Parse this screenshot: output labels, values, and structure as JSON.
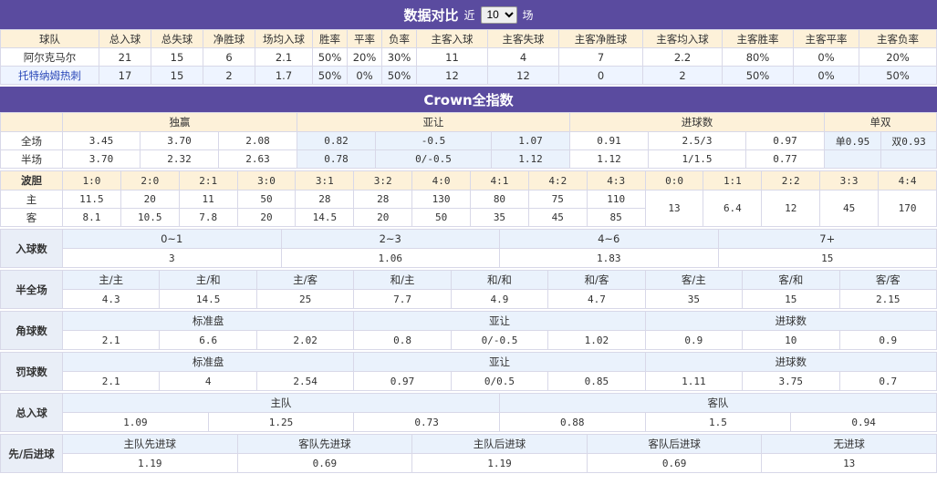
{
  "compare": {
    "title": "数据对比",
    "near": "近",
    "count": "10",
    "unit": "场",
    "headers": [
      "球队",
      "总入球",
      "总失球",
      "净胜球",
      "场均入球",
      "胜率",
      "平率",
      "负率",
      "主客入球",
      "主客失球",
      "主客净胜球",
      "主客均入球",
      "主客胜率",
      "主客平率",
      "主客负率"
    ],
    "rows": [
      [
        "阿尔克马尔",
        "21",
        "15",
        "6",
        "2.1",
        "50%",
        "20%",
        "30%",
        "11",
        "4",
        "7",
        "2.2",
        "80%",
        "0%",
        "20%"
      ],
      [
        "托特纳姆热刺",
        "17",
        "15",
        "2",
        "1.7",
        "50%",
        "0%",
        "50%",
        "12",
        "12",
        "0",
        "2",
        "50%",
        "0%",
        "50%"
      ]
    ]
  },
  "crown": {
    "title": "Crown全指数",
    "groups": [
      "独赢",
      "亚让",
      "进球数",
      "单双"
    ],
    "full": {
      "label": "全场",
      "vals": [
        "3.45",
        "3.70",
        "2.08",
        "0.82",
        "-0.5",
        "1.07",
        "0.91",
        "2.5/3",
        "0.97",
        "单0.95",
        "双0.93"
      ]
    },
    "half": {
      "label": "半场",
      "vals": [
        "3.70",
        "2.32",
        "2.63",
        "0.78",
        "0/-0.5",
        "1.12",
        "1.12",
        "1/1.5",
        "0.77",
        "",
        ""
      ]
    }
  },
  "cs": {
    "label": "波胆",
    "home": "主",
    "away": "客",
    "scores": [
      "1:0",
      "2:0",
      "2:1",
      "3:0",
      "3:1",
      "3:2",
      "4:0",
      "4:1",
      "4:2",
      "4:3",
      "0:0",
      "1:1",
      "2:2",
      "3:3",
      "4:4"
    ],
    "homeVals": [
      "11.5",
      "20",
      "11",
      "50",
      "28",
      "28",
      "130",
      "80",
      "75",
      "110"
    ],
    "awayVals": [
      "8.1",
      "10.5",
      "7.8",
      "20",
      "14.5",
      "20",
      "50",
      "35",
      "45",
      "85"
    ],
    "drawVals": [
      "13",
      "6.4",
      "12",
      "45",
      "170"
    ]
  },
  "goals": {
    "label": "入球数",
    "heads": [
      "0~1",
      "2~3",
      "4~6",
      "7+"
    ],
    "vals": [
      "3",
      "1.06",
      "1.83",
      "15"
    ]
  },
  "htft": {
    "label": "半全场",
    "heads": [
      "主/主",
      "主/和",
      "主/客",
      "和/主",
      "和/和",
      "和/客",
      "客/主",
      "客/和",
      "客/客"
    ],
    "vals": [
      "4.3",
      "14.5",
      "25",
      "7.7",
      "4.9",
      "4.7",
      "35",
      "15",
      "2.15"
    ]
  },
  "corner": {
    "label": "角球数",
    "heads": [
      "标准盘",
      "亚让",
      "进球数"
    ],
    "vals": [
      "2.1",
      "6.6",
      "2.02",
      "0.8",
      "0/-0.5",
      "1.02",
      "0.9",
      "10",
      "0.9"
    ]
  },
  "penalty": {
    "label": "罚球数",
    "heads": [
      "标准盘",
      "亚让",
      "进球数"
    ],
    "vals": [
      "2.1",
      "4",
      "2.54",
      "0.97",
      "0/0.5",
      "0.85",
      "1.11",
      "3.75",
      "0.7"
    ]
  },
  "total": {
    "label": "总入球",
    "heads": [
      "主队",
      "客队"
    ],
    "vals": [
      "1.09",
      "1.25",
      "0.73",
      "0.88",
      "1.5",
      "0.94"
    ]
  },
  "first": {
    "label": "先/后进球",
    "heads": [
      "主队先进球",
      "客队先进球",
      "主队后进球",
      "客队后进球",
      "无进球"
    ],
    "vals": [
      "1.19",
      "0.69",
      "1.19",
      "0.69",
      "13"
    ]
  }
}
